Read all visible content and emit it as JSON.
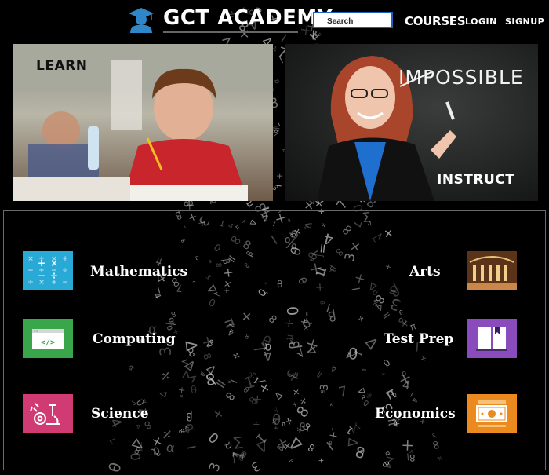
{
  "header": {
    "brand": "GCT ACADEMY",
    "search": {
      "placeholder": "Search",
      "value": ""
    },
    "nav": {
      "courses": "COURSES",
      "login": "LOGIN",
      "signup": "SIGNUP"
    }
  },
  "hero": {
    "learn_label": "LEARN",
    "instruct_label": "INSTRUCT",
    "chalkboard_text": "IMPOSSIBLE"
  },
  "courses": [
    {
      "label": "Mathematics",
      "icon": "calculator-icon",
      "color": "#29a9d6"
    },
    {
      "label": "Arts",
      "icon": "gallery-icon",
      "color": "#7a4a22"
    },
    {
      "label": "Computing",
      "icon": "code-window-icon",
      "color": "#3aa64b"
    },
    {
      "label": "Test Prep",
      "icon": "book-icon",
      "color": "#8a4bbd"
    },
    {
      "label": "Science",
      "icon": "microscope-icon",
      "color": "#d13b73"
    },
    {
      "label": "Economics",
      "icon": "money-icon",
      "color": "#ec8a1f"
    }
  ],
  "colors": {
    "background": "#000000",
    "search_border": "#1f5fbf"
  }
}
